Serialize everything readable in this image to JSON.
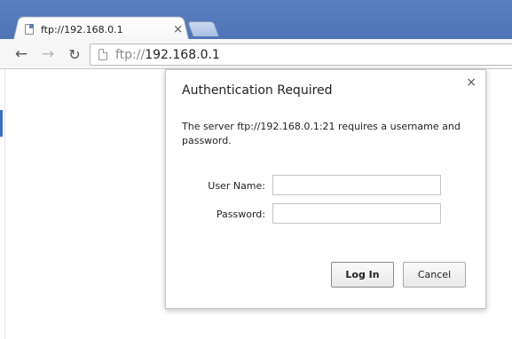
{
  "browser": {
    "tab": {
      "title": "ftp://192.168.0.1",
      "close_glyph": "×"
    },
    "nav": {
      "back_glyph": "←",
      "forward_glyph": "→",
      "reload_glyph": "↻"
    },
    "omnibox": {
      "scheme": "ftp://",
      "host": "192.168.0.1"
    }
  },
  "dialog": {
    "title": "Authentication Required",
    "close_glyph": "×",
    "message": "The server ftp://192.168.0.1:21 requires a username and password.",
    "fields": {
      "username_label": "User Name:",
      "username_value": "",
      "password_label": "Password:",
      "password_value": ""
    },
    "buttons": {
      "login": "Log In",
      "cancel": "Cancel"
    }
  },
  "colors": {
    "frame": "#5a7fc0",
    "toolbar": "#f6f6f6",
    "dialog_bg": "#ffffff",
    "border": "#c5c5c5"
  }
}
